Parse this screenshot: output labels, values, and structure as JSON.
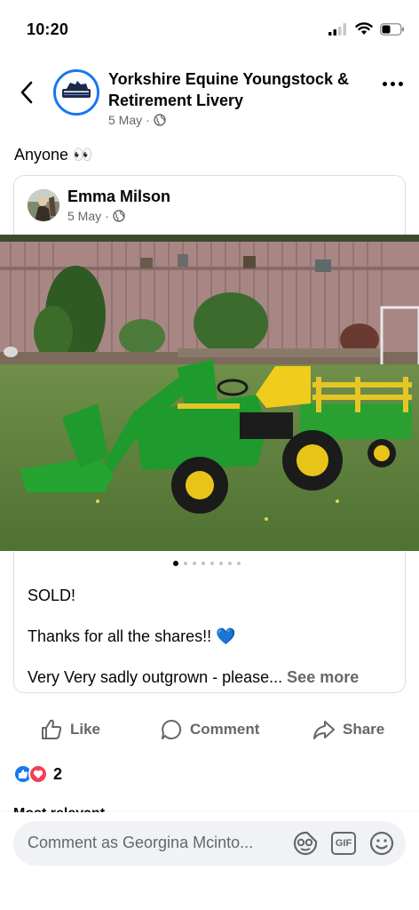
{
  "status": {
    "time": "10:20"
  },
  "post": {
    "group_name": "Yorkshire Equine Youngstock & Retirement Livery",
    "date": "5 May",
    "separator": "·",
    "text": "Anyone 👀"
  },
  "shared": {
    "author": "Emma Milson",
    "date": "5 May",
    "separator": "·",
    "line1": "SOLD!",
    "line2": "Thanks for all the shares!! 💙",
    "line3": "Very Very sadly outgrown - please...",
    "see_more": "See more",
    "photo_count": 8,
    "active_photo": 1
  },
  "actions": {
    "like": "Like",
    "comment": "Comment",
    "share": "Share"
  },
  "reactions": {
    "count": "2",
    "types": [
      "like",
      "love"
    ]
  },
  "sort": {
    "label": "Most relevant ⌄"
  },
  "comment_box": {
    "placeholder": "Comment as Georgina Mcinto..."
  },
  "icons": {
    "back": "chevron-left-icon",
    "more": "ellipsis-icon",
    "globe": "globe-icon",
    "sticker": "sticker-icon",
    "gif": "GIF",
    "emoji": "emoji-icon"
  },
  "colors": {
    "accent": "#1877f2",
    "secondary_text": "#65676b",
    "love": "#f33e58",
    "border": "#dadde1"
  }
}
